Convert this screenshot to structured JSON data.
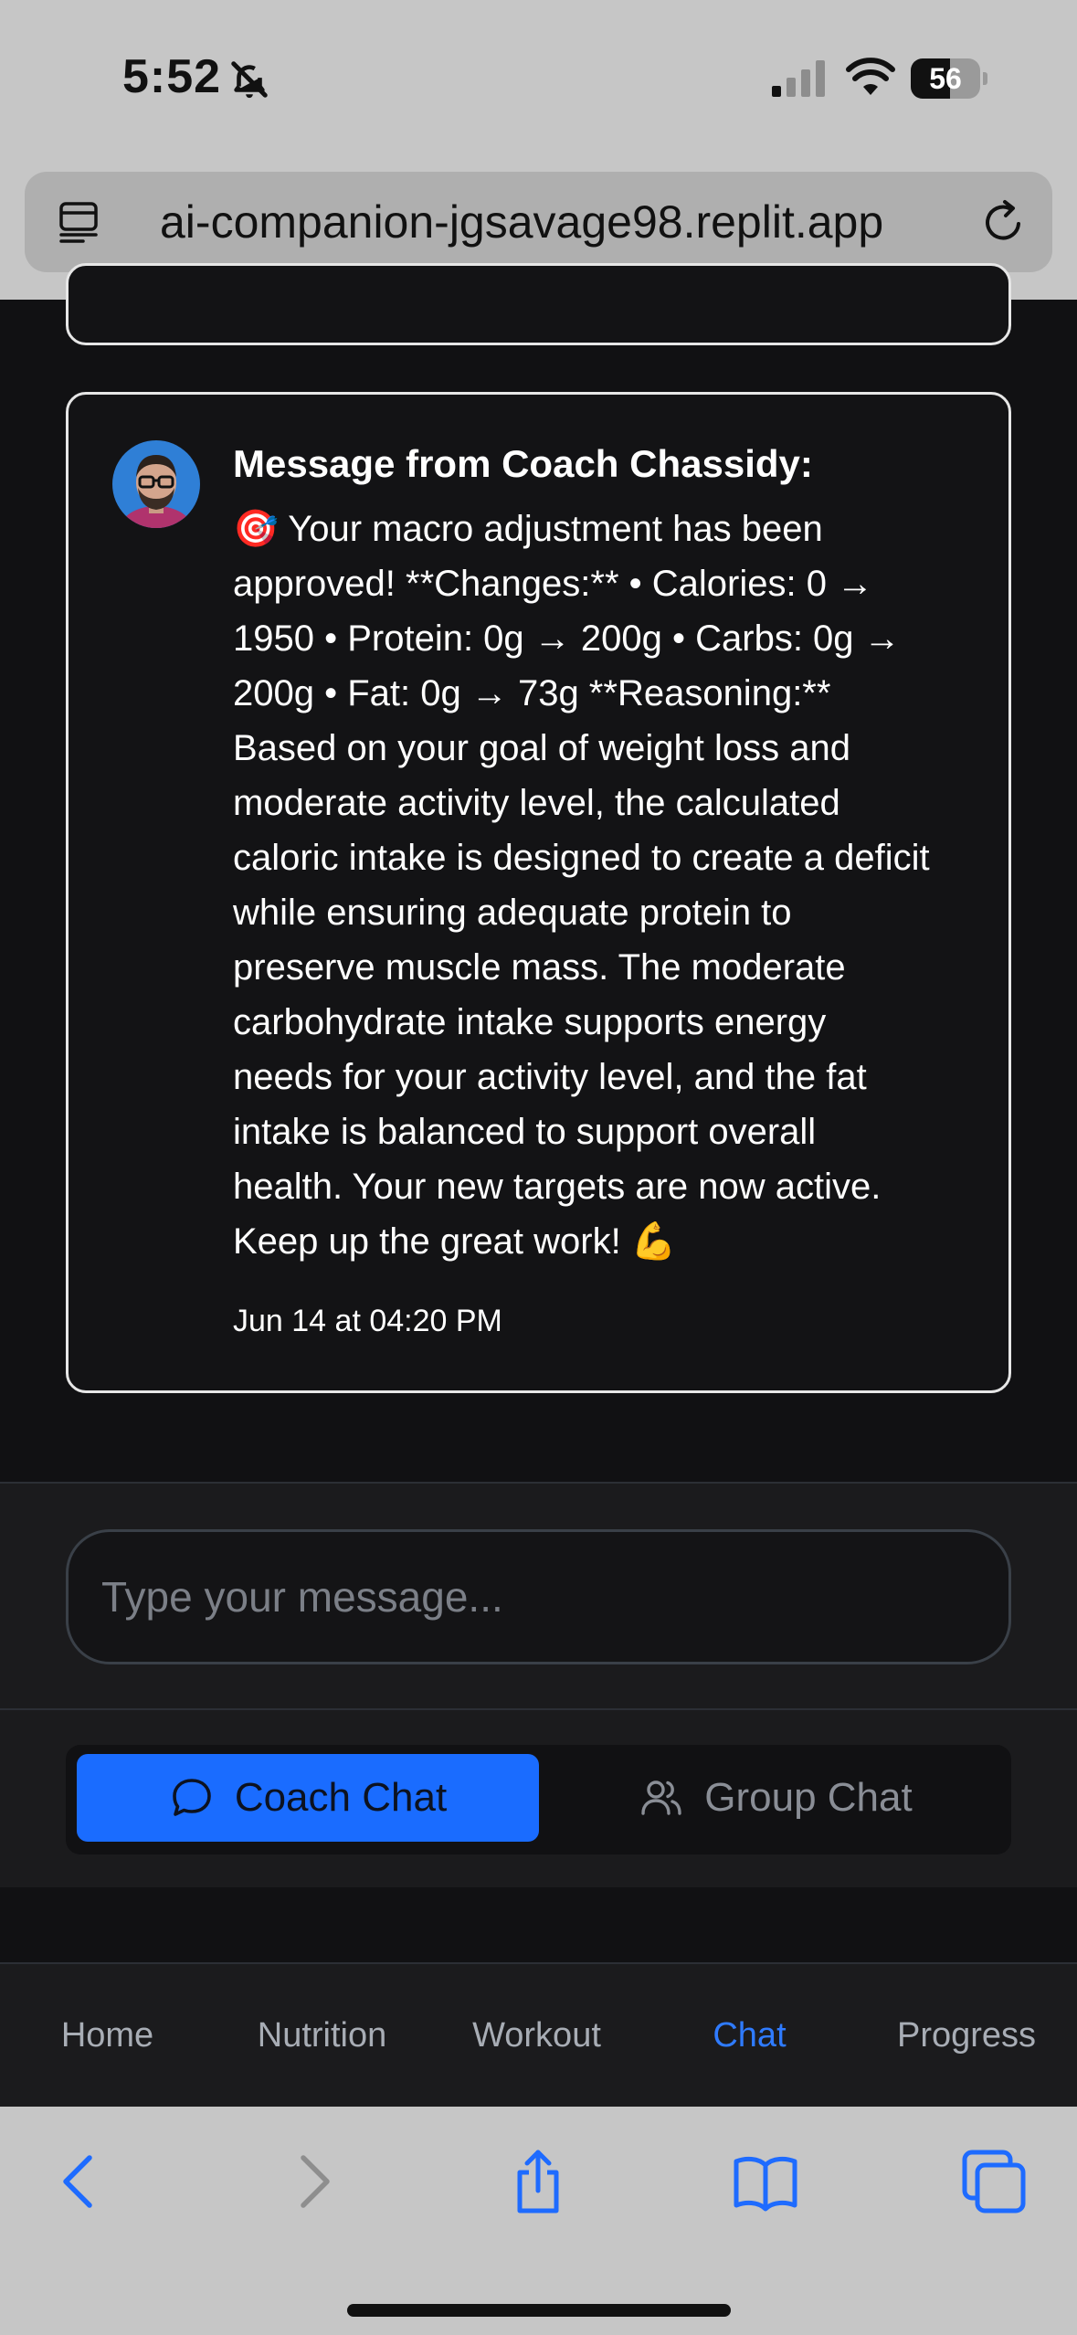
{
  "status_bar": {
    "time": "5:52",
    "battery_level": "56",
    "battery_fraction": 0.56
  },
  "browser": {
    "url": "ai-companion-jgsavage98.replit.app"
  },
  "message": {
    "title": "Message from Coach Chassidy:",
    "body": "🎯 Your macro adjustment has been\napproved! **Changes:** • Calories: 0 →\n1950 • Protein: 0g → 200g • Carbs: 0g →\n200g • Fat: 0g → 73g **Reasoning:**\nBased on your goal of weight loss and\nmoderate activity level, the calculated\ncaloric intake is designed to create a deficit\nwhile ensuring adequate protein to\npreserve muscle mass. The moderate\ncarbohydrate intake supports energy\nneeds for your activity level, and the fat\nintake is balanced to support overall\nhealth. Your new targets are now active.\nKeep up the great work! 💪",
    "timestamp": "Jun 14 at 04:20 PM"
  },
  "composer": {
    "placeholder": "Type your message..."
  },
  "chat_toggle": {
    "coach_label": "Coach Chat",
    "group_label": "Group Chat",
    "active": "Coach Chat"
  },
  "bottom_nav": {
    "items": [
      "Home",
      "Nutrition",
      "Workout",
      "Chat",
      "Progress"
    ],
    "active": "Chat"
  },
  "colors": {
    "accent": "#1a6cff",
    "nav_active": "#2f7bff",
    "background": "#111113",
    "card_border": "#e6e6e6"
  },
  "icons": {
    "toolbar": [
      "back-icon",
      "forward-icon",
      "share-icon",
      "bookmarks-icon",
      "tabs-icon"
    ]
  }
}
